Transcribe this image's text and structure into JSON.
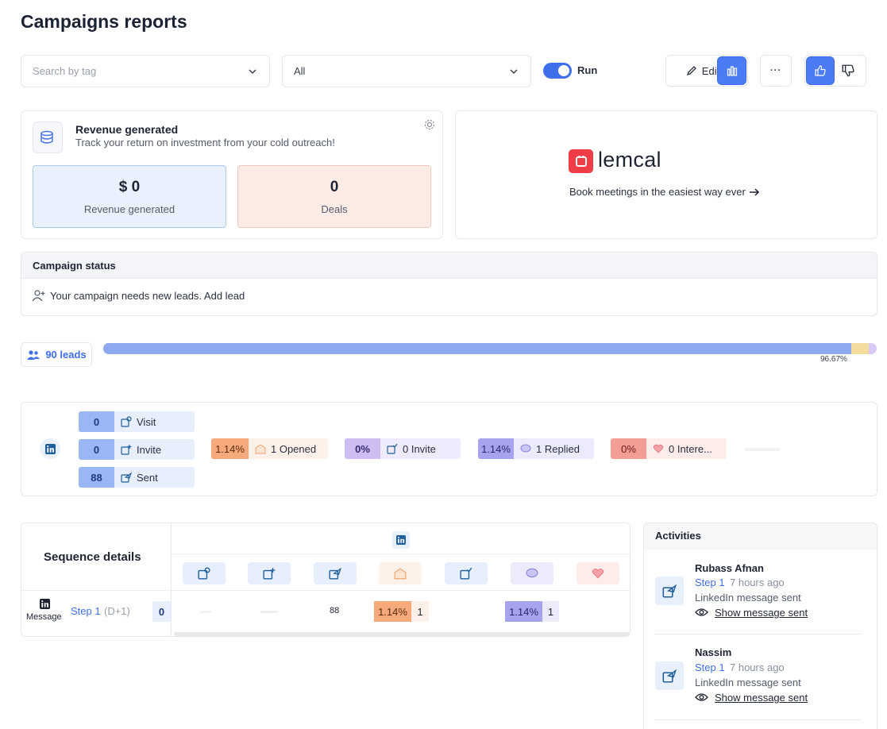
{
  "page": {
    "title": "Campaigns reports"
  },
  "toolbar": {
    "tag_placeholder": "Search by tag",
    "filter_value": "All",
    "run_label": "Run",
    "edit_label": "Edit",
    "more_label": "···"
  },
  "revenue": {
    "title": "Revenue generated",
    "subtitle": "Track your return on investment from your cold outreach!",
    "revenue_value": "$ 0",
    "revenue_label": "Revenue generated",
    "deals_value": "0",
    "deals_label": "Deals"
  },
  "promo": {
    "brand": "lemcal",
    "tagline": "Book meetings in the easiest way ever"
  },
  "campaign_status": {
    "title": "Campaign status",
    "message": "Your campaign needs new leads. Add lead"
  },
  "leads": {
    "count_label": "90 leads",
    "progress_percent": 96.67,
    "progress_label": "96.67%"
  },
  "funnel": {
    "linkedin_steps": [
      {
        "value": "0",
        "label": "Visit"
      },
      {
        "value": "0",
        "label": "Invite"
      },
      {
        "value": "88",
        "label": "Sent"
      }
    ],
    "metrics": [
      {
        "value": "1.14%",
        "label": "1 Opened"
      },
      {
        "value": "0%",
        "label": "0 Invite"
      },
      {
        "value": "1.14%",
        "label": "1 Replied"
      },
      {
        "value": "0%",
        "label": "0 Intere..."
      }
    ]
  },
  "sequence": {
    "title": "Sequence details",
    "row": {
      "type_label": "Message",
      "step_label": "Step 1",
      "delay_label": "(D+1)",
      "value": "0",
      "sent": "88",
      "opened_pct": "1.14%",
      "opened_count": "1",
      "replied_pct": "1.14%",
      "replied_count": "1"
    }
  },
  "activities": {
    "title": "Activities",
    "items": [
      {
        "name": "Rubass Afnan",
        "step": "Step 1",
        "time": "7 hours ago",
        "action": "LinkedIn message sent",
        "link": "Show message sent"
      },
      {
        "name": "Nassim",
        "step": "Step 1",
        "time": "7 hours ago",
        "action": "LinkedIn message sent",
        "link": "Show message sent"
      }
    ]
  },
  "colors": {
    "accent": "#4b7bf5",
    "opened": "#f6a97a",
    "invite": "#cdbdf3",
    "replied": "#a7a3ef",
    "interested": "#f39e95"
  }
}
